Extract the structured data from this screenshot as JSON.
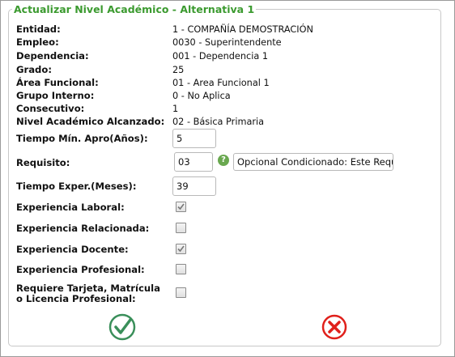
{
  "dialog": {
    "title": "Actualizar Nivel Académico - Alternativa 1"
  },
  "info": {
    "entidad_label": "Entidad:",
    "entidad_value": "1 - COMPAÑÍA DEMOSTRACIÓN",
    "empleo_label": "Empleo:",
    "empleo_value": "0030 - Superintendente",
    "dependencia_label": "Dependencia:",
    "dependencia_value": "001 - Dependencia 1",
    "grado_label": "Grado:",
    "grado_value": "25",
    "area_label": "Área Funcional:",
    "area_value": "01 - Area Funcional 1",
    "grupo_label": "Grupo Interno:",
    "grupo_value": "0 - No Aplica",
    "consecutivo_label": "Consecutivo:",
    "consecutivo_value": "1",
    "nivel_label": "Nivel Académico Alcanzado:",
    "nivel_value": "02 - Básica Primaria"
  },
  "form": {
    "tiempo_min_label": "Tiempo Mín. Apro(Años):",
    "tiempo_min_value": "5",
    "requisito_label": "Requisito:",
    "requisito_code": "03",
    "requisito_desc": "Opcional Condicionado: Este Requisit",
    "tiempo_exper_label": "Tiempo Exper.(Meses):",
    "tiempo_exper_value": "39",
    "exp_laboral_label": "Experiencia Laboral:",
    "exp_laboral_checked": true,
    "exp_relacionada_label": "Experiencia Relacionada:",
    "exp_relacionada_checked": false,
    "exp_docente_label": "Experiencia Docente:",
    "exp_docente_checked": true,
    "exp_profesional_label": "Experiencia Profesional:",
    "exp_profesional_checked": false,
    "tarjeta_label_line1": "Requiere Tarjeta, Matrícula",
    "tarjeta_label_line2": "o Licencia Profesional:",
    "tarjeta_checked": false
  },
  "icons": {
    "help": "question-icon",
    "accept": "checkmark-icon",
    "cancel": "close-icon"
  },
  "colors": {
    "title": "#3b9a2f",
    "accept": "#3a8f5a",
    "cancel": "#e0201b"
  }
}
